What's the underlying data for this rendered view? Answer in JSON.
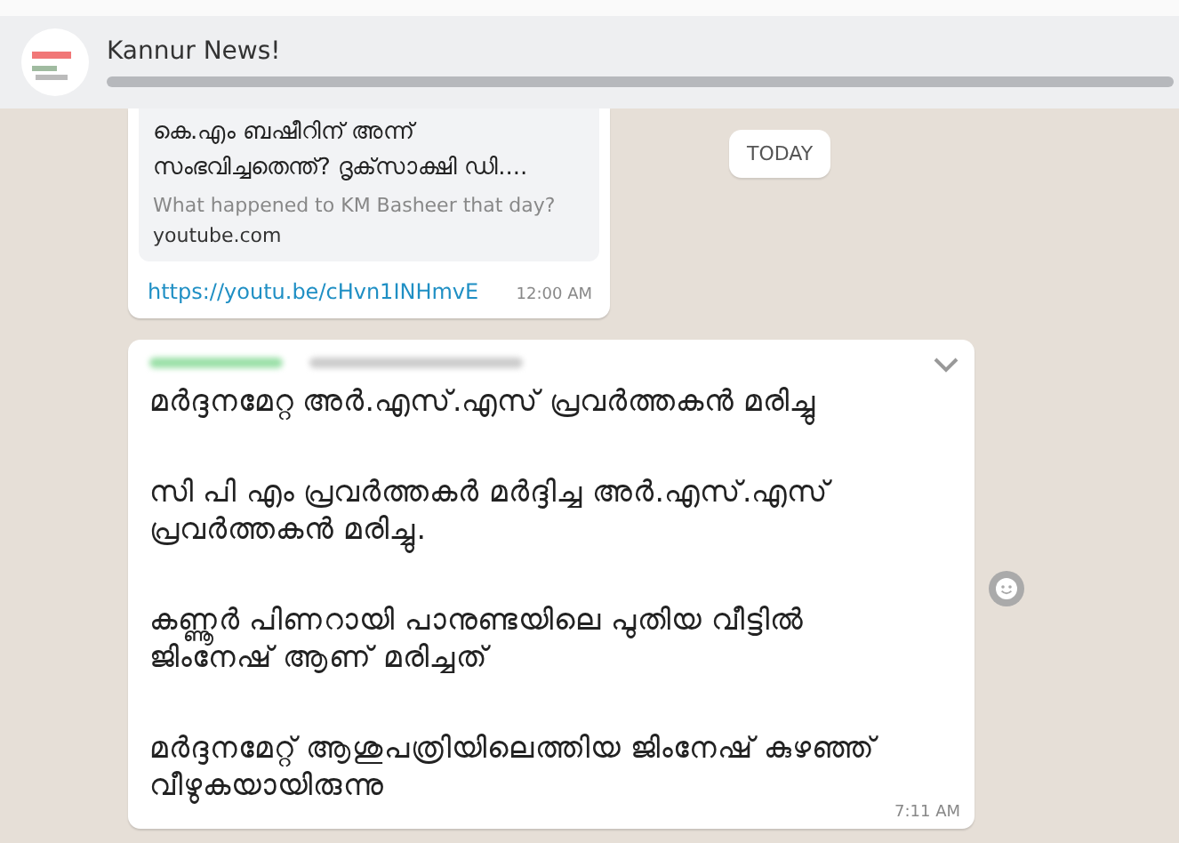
{
  "header": {
    "title": "Kannur News!"
  },
  "date_badge": "TODAY",
  "link_message": {
    "preview_title": "കെ.എം ബഷീറിന് അന്ന് സംഭവിച്ചതെന്ത്? ദൃക്‌സാക്ഷി ഡി....",
    "preview_description": "What happened to KM Basheer that day?",
    "preview_domain": "youtube.com",
    "url": "https://youtu.be/cHvn1INHmvE",
    "time": "12:00 AM"
  },
  "text_message": {
    "paragraphs": [
      {
        "text": "മർദ്ദനമേറ്റ അർ.എസ്.എസ് പ്രവർത്തകൻ മരിച്ചു"
      },
      {
        "text": "സി പി എം പ്രവർത്തകർ മർദ്ദിച്ച അർ.എസ്.എസ് പ്രവർത്തകൻ മരിച്ചു."
      },
      {
        "text": "കണ്ണൂർ പിണറായി പാനുണ്ടയിലെ പുതിയ വീട്ടിൽ ജിംനേഷ് ആണ് മരിച്ചത്"
      },
      {
        "text": "മർദ്ദനമേറ്റ് ആശുപത്രിയിലെത്തിയ ജിംനേഷ് കുഴഞ്ഞ് വീഴുകയായിരുന്നു"
      }
    ],
    "time": "7:11 AM"
  }
}
